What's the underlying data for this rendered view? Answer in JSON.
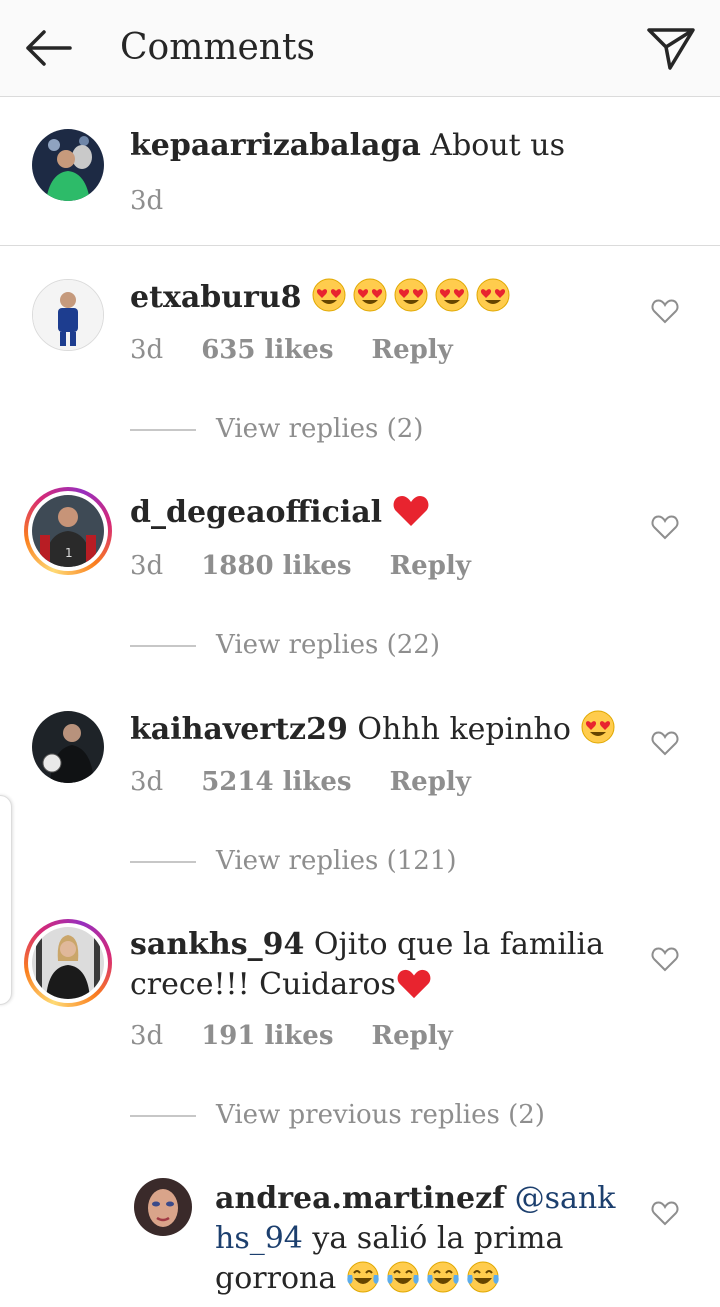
{
  "header": {
    "title": "Comments",
    "back_icon": "back-arrow-icon",
    "send_icon": "paper-plane-icon"
  },
  "caption": {
    "username": "kepaarrizabalaga",
    "text": " About us",
    "time": "3d"
  },
  "comments": [
    {
      "username": "etxaburu8",
      "text": "",
      "emojis": 5,
      "emoji": "heart-eyes",
      "time": "3d",
      "likes": "635 likes",
      "reply": "Reply",
      "view_replies": "View replies (2)"
    },
    {
      "username": "d_degeaofficial",
      "text": "",
      "emoji": "red-heart",
      "time": "3d",
      "likes": "1880 likes",
      "reply": "Reply",
      "view_replies": "View replies (22)"
    },
    {
      "username": "kaihavertz29",
      "text": " Ohhh kepinho",
      "emoji": "heart-eyes",
      "time": "3d",
      "likes": "5214 likes",
      "reply": "Reply",
      "view_replies": "View replies (121)"
    },
    {
      "username": "sankhs_94",
      "text": " Ojito que la familia crece!!! Cuidaros",
      "emoji": "red-heart",
      "time": "3d",
      "likes": "191 likes",
      "reply": "Reply",
      "view_replies": "View previous replies (2)"
    }
  ],
  "nested_reply": {
    "username": "andrea.martinezf",
    "mention": "@sankhs_94",
    "text": " ya salió la prima gorrona",
    "emoji": "tears-of-joy",
    "emoji_count": 4
  },
  "colors": {
    "text": "#262626",
    "meta": "#8e8e8e",
    "mention": "#1c3f6e",
    "heart": "#e8242f"
  }
}
